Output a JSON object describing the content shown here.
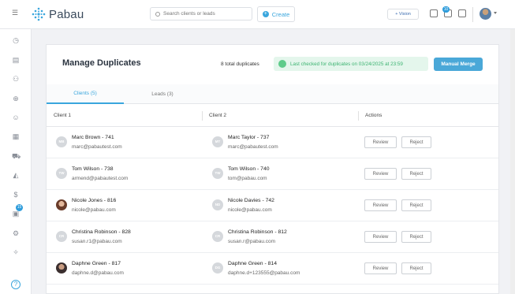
{
  "app": {
    "name": "Pabau",
    "brand_color": "#3aa6dd"
  },
  "topbar": {
    "search_placeholder": "Search clients or leads",
    "create_label": "Create",
    "vision_label": "+ Vision",
    "notification_count": "10"
  },
  "sidebar": {
    "badge_count": "15",
    "help_label": "?"
  },
  "page": {
    "title": "Manage Duplicates",
    "total": "8 total duplicates",
    "last_checked": "Last checked for duplicates on 03/24/2025 at 23:59",
    "manual_merge": "Manual Merge",
    "tabs": [
      {
        "label": "Clients (5)",
        "active": true
      },
      {
        "label": "Leads (3)",
        "active": false
      }
    ],
    "columns": {
      "client1": "Client 1",
      "client2": "Client 2",
      "actions": "Actions"
    },
    "review_label": "Review",
    "reject_label": "Reject",
    "rows": [
      {
        "c1": {
          "initials": "MB",
          "name": "Marc Brown - 741",
          "email": "marc@pabautest.com"
        },
        "c2": {
          "initials": "MT",
          "name": "Marc Taylor - 737",
          "email": "marc@pabautest.com"
        }
      },
      {
        "c1": {
          "initials": "TW",
          "name": "Tom Wilson - 738",
          "email": "armend@pabautest.com"
        },
        "c2": {
          "initials": "TW",
          "name": "Tom Wilson - 740",
          "email": "tom@pabau.com"
        }
      },
      {
        "c1": {
          "initials": "",
          "name": "Nicole Jones - 816",
          "email": "nicole@pabau.com"
        },
        "c2": {
          "initials": "ND",
          "name": "Nicole Davies - 742",
          "email": "nicole@pabau.com"
        }
      },
      {
        "c1": {
          "initials": "CR",
          "name": "Christina Robinson - 828",
          "email": "susan.r1@pabau.com"
        },
        "c2": {
          "initials": "CR",
          "name": "Christina Robinson - 812",
          "email": "susan.r@pabau.com"
        }
      },
      {
        "c1": {
          "initials": "",
          "name": "Daphne Green - 817",
          "email": "daphne.d@pabau.com"
        },
        "c2": {
          "initials": "DG",
          "name": "Daphne Green - 814",
          "email": "daphne.d+123555@pabau.com"
        }
      }
    ]
  }
}
